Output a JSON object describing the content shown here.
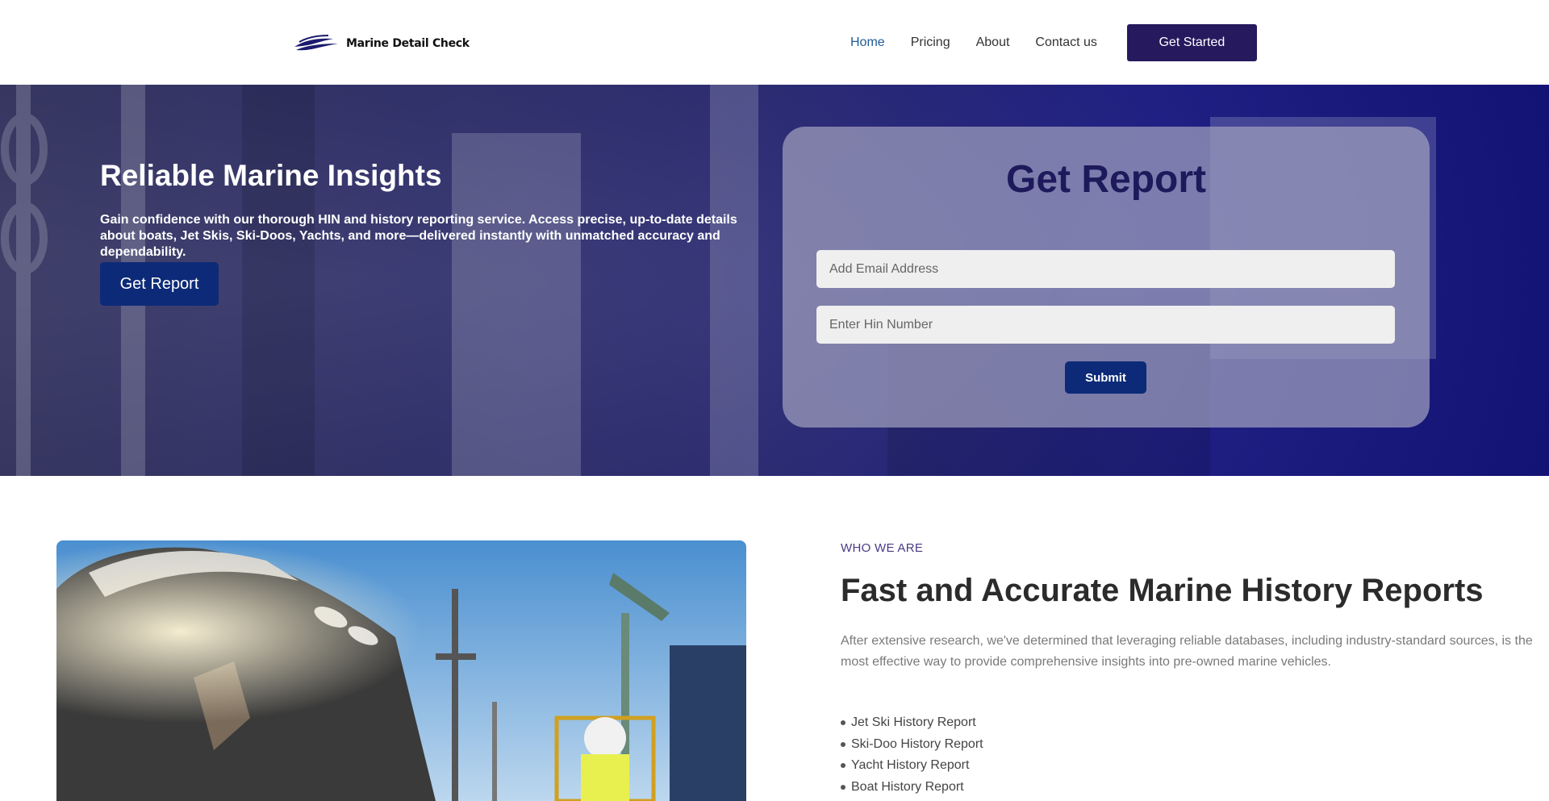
{
  "header": {
    "logo_text": "Marine Detail Check",
    "nav": [
      {
        "label": "Home",
        "active": true
      },
      {
        "label": "Pricing",
        "active": false
      },
      {
        "label": "About",
        "active": false
      },
      {
        "label": "Contact us",
        "active": false
      }
    ],
    "cta_label": "Get Started"
  },
  "hero": {
    "title": "Reliable Marine Insights",
    "text": "Gain confidence with our thorough HIN and history reporting service. Access precise, up-to-date details about boats, Jet Skis, Ski-Doos, Yachts, and more—delivered instantly with unmatched accuracy and dependability.",
    "button_label": "Get Report"
  },
  "report_form": {
    "title": "Get Report",
    "email_placeholder": "Add Email Address",
    "email_value": "",
    "hin_placeholder": "Enter Hin Number",
    "hin_value": "",
    "submit_label": "Submit"
  },
  "about": {
    "eyebrow": "WHO WE ARE",
    "title": "Fast and Accurate Marine History Reports",
    "text": "After extensive research, we've determined that leveraging reliable databases, including industry-standard sources, is the most effective way to provide comprehensive insights into pre-owned marine vehicles.",
    "features": [
      "Jet Ski History Report",
      "Ski-Doo History Report",
      "Yacht History Report",
      "Boat History Report"
    ]
  },
  "colors": {
    "brand_dark": "#26195e",
    "button_blue": "#0d2a78",
    "active_link": "#1f5b95"
  },
  "icons": {
    "logo": "boat-waves-logo-icon",
    "bullet": "dot-icon"
  }
}
